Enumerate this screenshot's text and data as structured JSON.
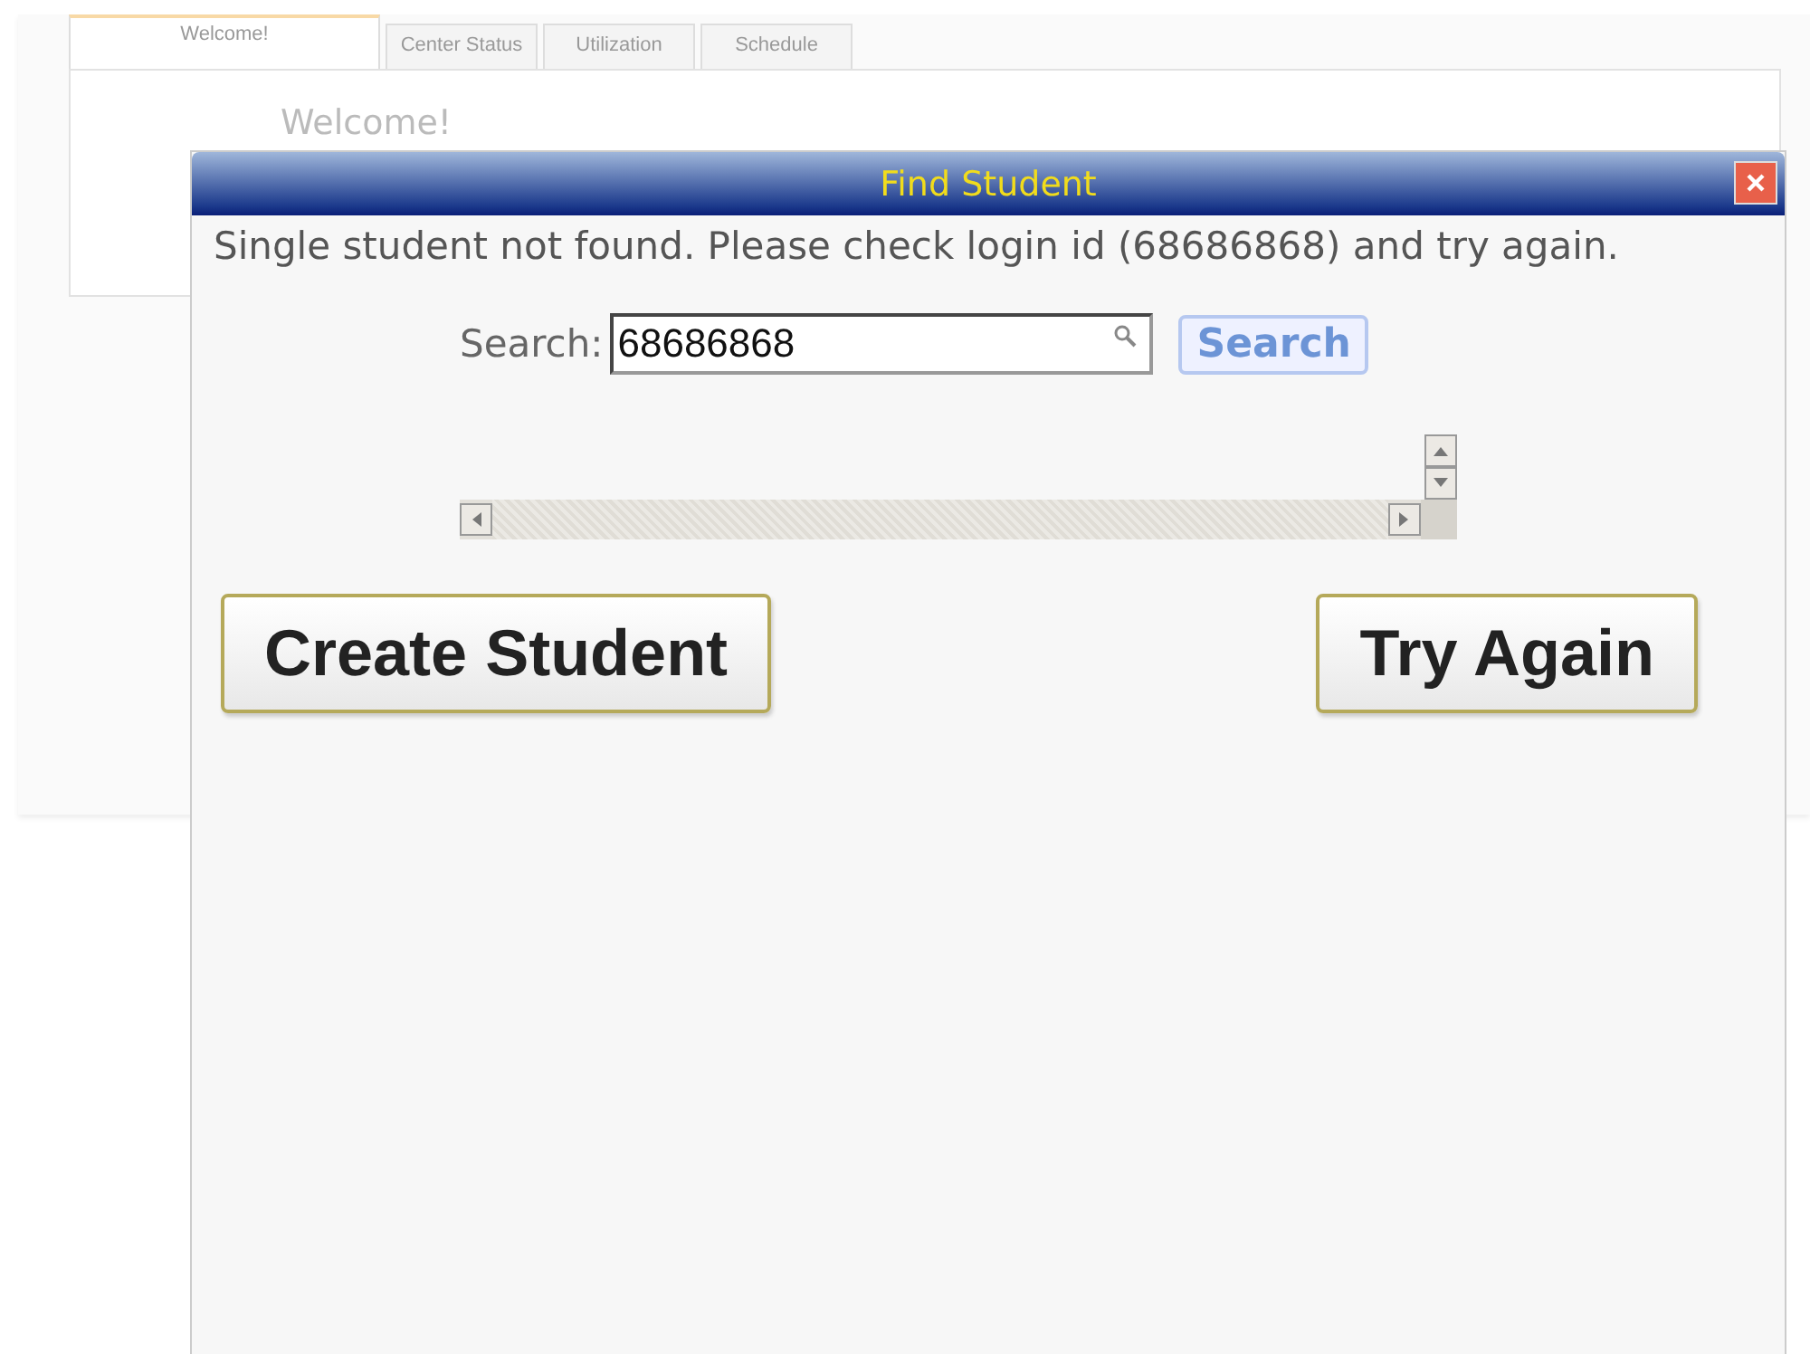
{
  "tabs": [
    {
      "label": "Welcome!",
      "selected": true
    },
    {
      "label": "Center Status",
      "selected": false
    },
    {
      "label": "Utilization",
      "selected": false
    },
    {
      "label": "Schedule",
      "selected": false
    }
  ],
  "welcome_heading": "Welcome!",
  "dialog": {
    "title": "Find Student",
    "message": "Single student not found. Please check login id (68686868) and try again.",
    "search_label": "Search:",
    "search_value": "68686868",
    "search_button": "Search",
    "buttons": [
      "Create Student",
      "Try Again"
    ]
  }
}
